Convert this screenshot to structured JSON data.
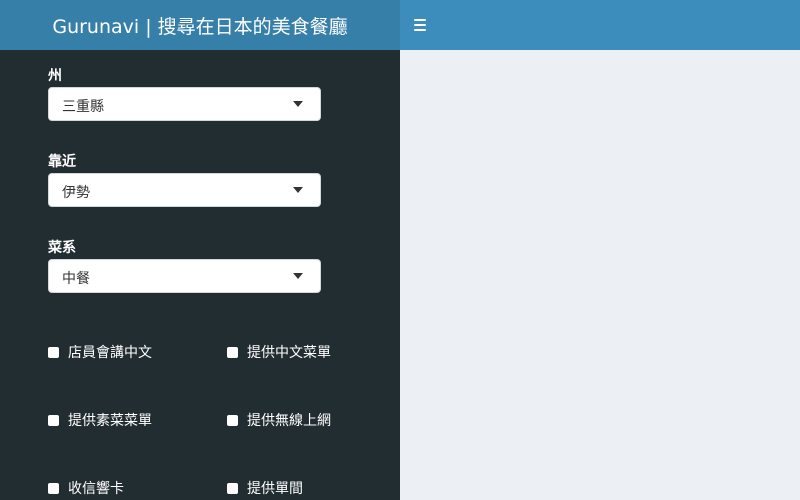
{
  "header": {
    "title": "Gurunavi | 搜尋在日本的美食餐廳"
  },
  "sidebar": {
    "state": {
      "label": "州",
      "value": "三重縣"
    },
    "nearby": {
      "label": "靠近",
      "value": "伊勢"
    },
    "cuisine": {
      "label": "菜系",
      "value": "中餐"
    },
    "checkboxes": [
      {
        "label": "店員會講中文",
        "checked": false
      },
      {
        "label": "提供中文菜單",
        "checked": false
      },
      {
        "label": "提供素菜菜單",
        "checked": false
      },
      {
        "label": "提供無線上網",
        "checked": false
      },
      {
        "label": "收信響卡",
        "checked": false
      },
      {
        "label": "提供單間",
        "checked": false
      }
    ]
  },
  "colors": {
    "header_left": "#367fa9",
    "header_right": "#3c8dbc",
    "sidebar": "#222d32",
    "content": "#ecf0f5"
  }
}
